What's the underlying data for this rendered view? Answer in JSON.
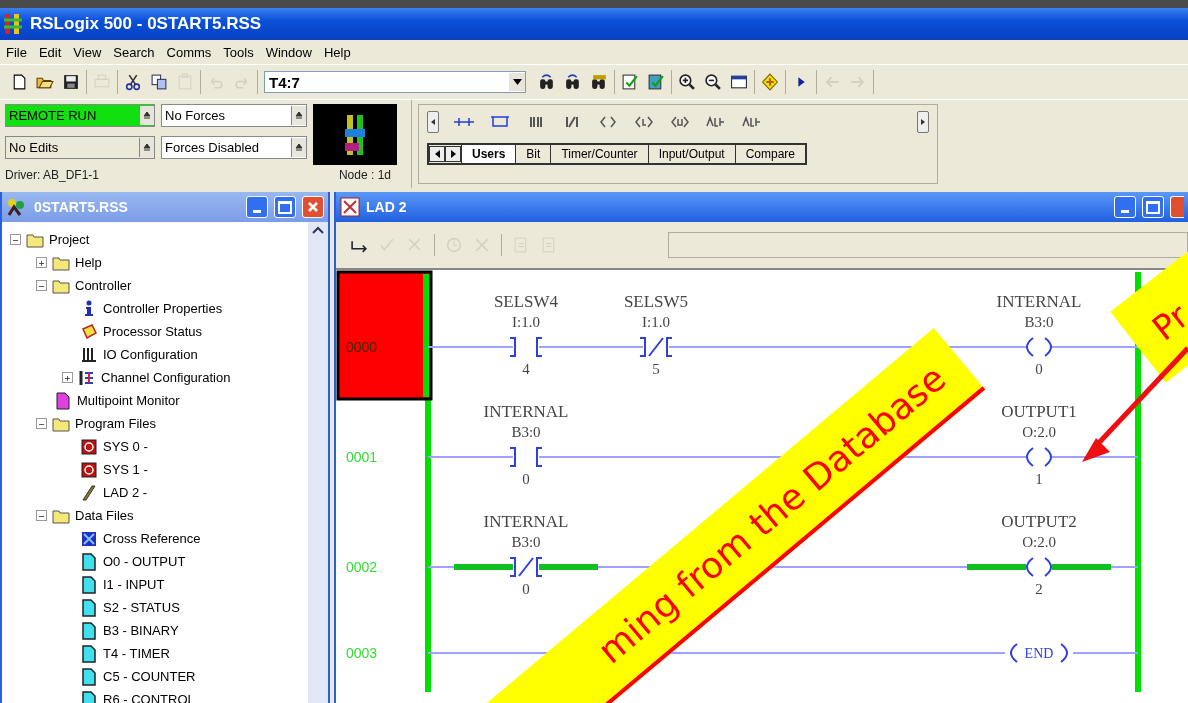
{
  "window": {
    "title": "RSLogix 500 - 0START5.RSS"
  },
  "menu": [
    "File",
    "Edit",
    "View",
    "Search",
    "Comms",
    "Tools",
    "Window",
    "Help"
  ],
  "toolbar": {
    "address": "T4:7",
    "groups_before": [
      [
        {
          "kind": "new",
          "disabled": false
        },
        {
          "kind": "open",
          "disabled": false
        },
        {
          "kind": "save",
          "disabled": false
        }
      ],
      [
        {
          "kind": "print",
          "disabled": true
        }
      ],
      [
        {
          "kind": "cut",
          "disabled": false
        },
        {
          "kind": "copy",
          "disabled": false
        },
        {
          "kind": "paste",
          "disabled": true
        }
      ],
      [
        {
          "kind": "undo",
          "disabled": true
        },
        {
          "kind": "redo",
          "disabled": true
        }
      ]
    ],
    "groups_after": [
      [
        {
          "kind": "find",
          "disabled": false
        },
        {
          "kind": "replace",
          "disabled": false
        },
        {
          "kind": "findall",
          "disabled": false
        }
      ],
      [
        {
          "kind": "verify",
          "disabled": false
        },
        {
          "kind": "verifyall",
          "disabled": false
        }
      ],
      [
        {
          "kind": "zoomin",
          "disabled": false
        },
        {
          "kind": "zoomout",
          "disabled": false
        },
        {
          "kind": "window",
          "disabled": false
        }
      ],
      [
        {
          "kind": "diamond",
          "disabled": false
        }
      ],
      [
        {
          "kind": "run",
          "disabled": false
        }
      ],
      [
        {
          "kind": "back",
          "disabled": true
        },
        {
          "kind": "forward",
          "disabled": true
        }
      ]
    ]
  },
  "status": {
    "mode": "REMOTE RUN",
    "running": true,
    "edits": "No Edits",
    "forces": "No Forces",
    "forces_state": "Forces Disabled",
    "driver": "Driver: AB_DF1-1",
    "node": "Node : 1d"
  },
  "palette": {
    "instructions": [
      {
        "kind": "rung"
      },
      {
        "kind": "branch"
      },
      {
        "kind": "xic"
      },
      {
        "kind": "xio"
      },
      {
        "kind": "ote"
      },
      {
        "kind": "otl"
      },
      {
        "kind": "otu"
      },
      {
        "kind": "abl"
      },
      {
        "kind": "abs"
      }
    ],
    "tabs": [
      {
        "label": "Users",
        "selected": true
      },
      {
        "label": "Bit",
        "selected": false
      },
      {
        "label": "Timer/Counter",
        "selected": false
      },
      {
        "label": "Input/Output",
        "selected": false
      },
      {
        "label": "Compare",
        "selected": false
      }
    ]
  },
  "project_window": {
    "title": "0START5.RSS",
    "tree": [
      {
        "label": "Project",
        "kind": "folder",
        "expanded": true,
        "children": [
          {
            "label": "Help",
            "kind": "folder",
            "expanded": false
          },
          {
            "label": "Controller",
            "kind": "folder",
            "expanded": true,
            "children": [
              {
                "label": "Controller Properties",
                "kind": "info"
              },
              {
                "label": "Processor Status",
                "kind": "status"
              },
              {
                "label": "IO Configuration",
                "kind": "io"
              },
              {
                "label": "Channel Configuration",
                "kind": "channel",
                "expanded": false
              }
            ]
          },
          {
            "label": "Multipoint Monitor",
            "kind": "monitor"
          },
          {
            "label": "Program Files",
            "kind": "folder",
            "expanded": true,
            "children": [
              {
                "label": "SYS 0 -",
                "kind": "system"
              },
              {
                "label": "SYS 1 -",
                "kind": "system"
              },
              {
                "label": "LAD 2 -",
                "kind": "ladder"
              }
            ]
          },
          {
            "label": "Data Files",
            "kind": "folder",
            "expanded": true,
            "children": [
              {
                "label": "Cross Reference",
                "kind": "crossref"
              },
              {
                "label": "O0 - OUTPUT",
                "kind": "data"
              },
              {
                "label": "I1 - INPUT",
                "kind": "data"
              },
              {
                "label": "S2 - STATUS",
                "kind": "data"
              },
              {
                "label": "B3 - BINARY",
                "kind": "data"
              },
              {
                "label": "T4 - TIMER",
                "kind": "data"
              },
              {
                "label": "C5 - COUNTER",
                "kind": "data"
              },
              {
                "label": "R6 - CONTROL",
                "kind": "data"
              }
            ]
          }
        ]
      }
    ]
  },
  "ladder_window": {
    "title": "LAD 2",
    "tools": [
      {
        "kind": "rungtool",
        "disabled": false
      },
      {
        "kind": "accept",
        "disabled": true
      },
      {
        "kind": "cancel",
        "disabled": true
      },
      {
        "kind": "test",
        "disabled": true
      },
      {
        "kind": "delete",
        "disabled": true
      },
      {
        "kind": "assemble",
        "disabled": true
      },
      {
        "kind": "unassemble",
        "disabled": true
      }
    ],
    "rungs": [
      {
        "number": "0000",
        "selected": true,
        "instructions": [
          {
            "kind": "xic",
            "tag": "SELSW4",
            "address": "I:1.0",
            "bit": "4",
            "energized": false
          },
          {
            "kind": "xio",
            "tag": "SELSW5",
            "address": "I:1.0",
            "bit": "5",
            "energized": false
          },
          {
            "kind": "ote",
            "tag": "INTERNAL",
            "address": "B3:0",
            "bit": "0",
            "energized": false
          }
        ]
      },
      {
        "number": "0001",
        "selected": false,
        "instructions": [
          {
            "kind": "xic",
            "tag": "INTERNAL",
            "address": "B3:0",
            "bit": "0",
            "energized": false
          },
          {
            "kind": "ote",
            "tag": "OUTPUT1",
            "address": "O:2.0",
            "bit": "1",
            "energized": false
          }
        ]
      },
      {
        "number": "0002",
        "selected": false,
        "instructions": [
          {
            "kind": "xio",
            "tag": "INTERNAL",
            "address": "B3:0",
            "bit": "0",
            "energized": true
          },
          {
            "kind": "ote",
            "tag": "OUTPUT2",
            "address": "O:2.0",
            "bit": "2",
            "energized": true
          }
        ]
      },
      {
        "number": "0003",
        "selected": false,
        "instructions": [
          {
            "kind": "end",
            "tag": "END"
          }
        ]
      }
    ]
  },
  "annotations": [
    {
      "text": "ming from the Database"
    },
    {
      "text": "Pr"
    }
  ]
}
